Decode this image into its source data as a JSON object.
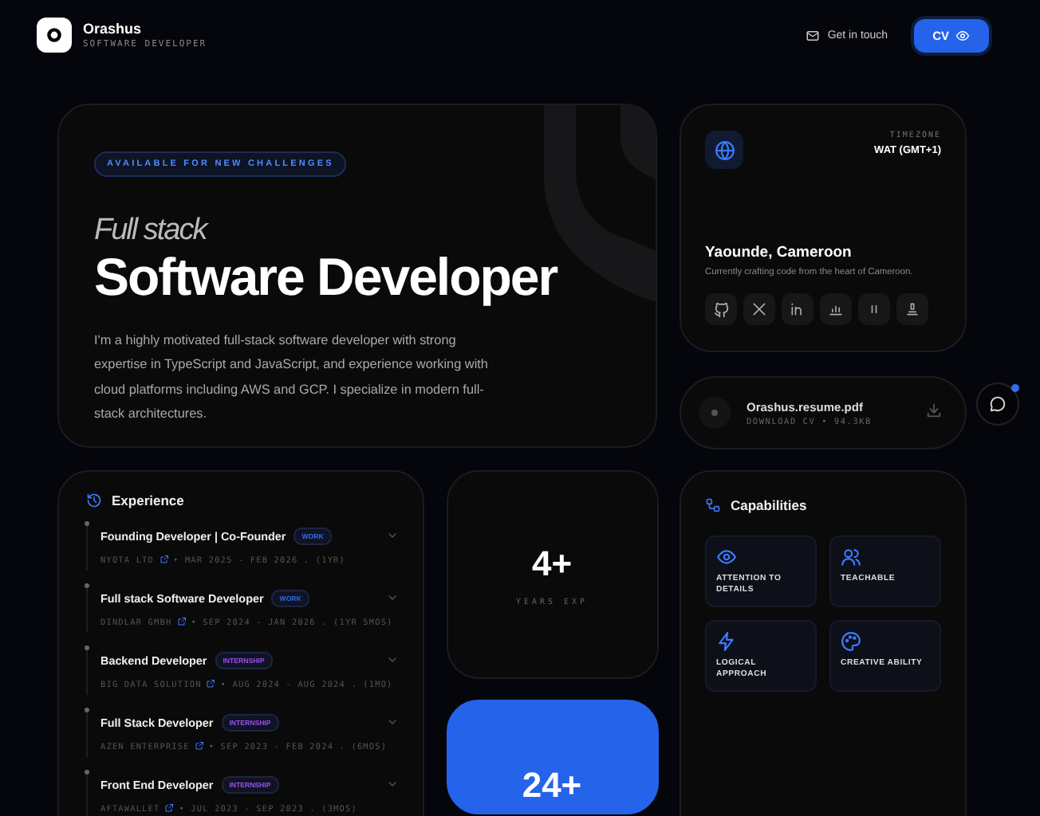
{
  "header": {
    "name": "Orashus",
    "role": "SOFTWARE DEVELOPER",
    "contact_link": "Get in touch",
    "cv_button": "CV"
  },
  "hero": {
    "badge": "AVAILABLE FOR NEW CHALLENGES",
    "kicker": "Full stack",
    "title": "Software Developer",
    "bio": "I'm a highly motivated full-stack software developer with strong expertise in TypeScript and JavaScript, and experience working with cloud platforms including AWS and GCP. I specialize in modern full-stack architectures."
  },
  "location": {
    "timezone_label": "TIMEZONE",
    "timezone": "WAT (GMT+1)",
    "city": "Yaounde, Cameroon",
    "note": "Currently crafting code from the heart of Cameroon.",
    "socials": [
      {
        "kind": "github"
      },
      {
        "kind": "x"
      },
      {
        "kind": "linkedin"
      },
      {
        "kind": "chart"
      },
      {
        "kind": "pause"
      },
      {
        "kind": "stack"
      }
    ]
  },
  "resume": {
    "file": "Orashus.resume.pdf",
    "meta": "DOWNLOAD CV • 94.3KB"
  },
  "chat": {
    "unread": true
  },
  "experience": {
    "title": "Experience",
    "items": [
      {
        "role": "Founding Developer | Co-Founder",
        "tag": "WORK",
        "color": "#2f6df0",
        "company": "NYOTA LTD",
        "period": "• MAR 2025 - FEB 2026 . (1YR)"
      },
      {
        "role": "Full stack Software Developer",
        "tag": "WORK",
        "color": "#2f6df0",
        "company": "DINDLAR GMBH",
        "period": "• SEP 2024 - JAN 2026 . (1YR 5MOS)"
      },
      {
        "role": "Backend Developer",
        "tag": "INTERNSHIP",
        "color": "#9b4ff0",
        "company": "BIG DATA SOLUTION",
        "period": "• AUG 2024 - AUG 2024 . (1MO)"
      },
      {
        "role": "Full Stack Developer",
        "tag": "INTERNSHIP",
        "color": "#9b4ff0",
        "company": "AZEN ENTERPRISE",
        "period": "• SEP 2023 - FEB 2024 . (6MOS)"
      },
      {
        "role": "Front End Developer",
        "tag": "INTERNSHIP",
        "color": "#9b4ff0",
        "company": "AFTAWALLET",
        "period": "• JUL 2023 - SEP 2023 . (3MOS)"
      }
    ]
  },
  "stats": [
    {
      "value": "4+",
      "label": "YEARS EXP",
      "kind": "dark"
    },
    {
      "value": "24+",
      "kind": "accent"
    }
  ],
  "capabilities": {
    "title": "Capabilities",
    "items": [
      {
        "kind": "eye",
        "label": "ATTENTION TO DETAILS"
      },
      {
        "kind": "people",
        "label": "TEACHABLE"
      },
      {
        "kind": "bolt",
        "label": "LOGICAL APPROACH"
      },
      {
        "kind": "palette",
        "label": "CREATIVE ABILITY"
      }
    ]
  }
}
